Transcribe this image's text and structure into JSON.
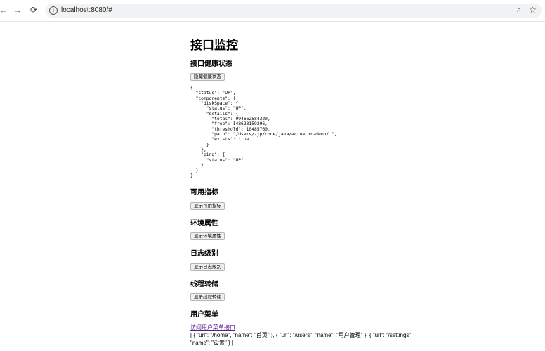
{
  "browser": {
    "url": "localhost:8080/#",
    "back_icon": "←",
    "forward_icon": "→",
    "reload_icon": "⟳"
  },
  "page": {
    "title": "接口监控",
    "health": {
      "heading": "接口健康状态",
      "button": "隐藏健康状态",
      "json": "{\n  \"status\": \"UP\",\n  \"components\": {\n    \"diskSpace\": {\n      \"status\": \"UP\",\n      \"details\": {\n        \"total\": 994662584320,\n        \"free\": 148623159296,\n        \"threshold\": 10485760,\n        \"path\": \"/Users/zjp/code/java/actuator-demo/.\",\n        \"exists\": true\n      }\n    },\n    \"ping\": {\n      \"status\": \"UP\"\n    }\n  }\n}"
    },
    "metrics": {
      "heading": "可用指标",
      "button": "显示可用指标"
    },
    "env": {
      "heading": "环境属性",
      "button": "显示环境属性"
    },
    "loggers": {
      "heading": "日志级别",
      "button": "显示日志级别"
    },
    "threaddump": {
      "heading": "线程转储",
      "button": "显示线程转储"
    },
    "menu": {
      "heading": "用户菜单",
      "link": "访问用户菜单接口",
      "result": "[ { \"url\": \"/home\", \"name\": \"首页\" }, { \"url\": \"/users\", \"name\": \"用户管理\" }, { \"url\": \"/settings\", \"name\": \"设置\" } ]"
    }
  }
}
